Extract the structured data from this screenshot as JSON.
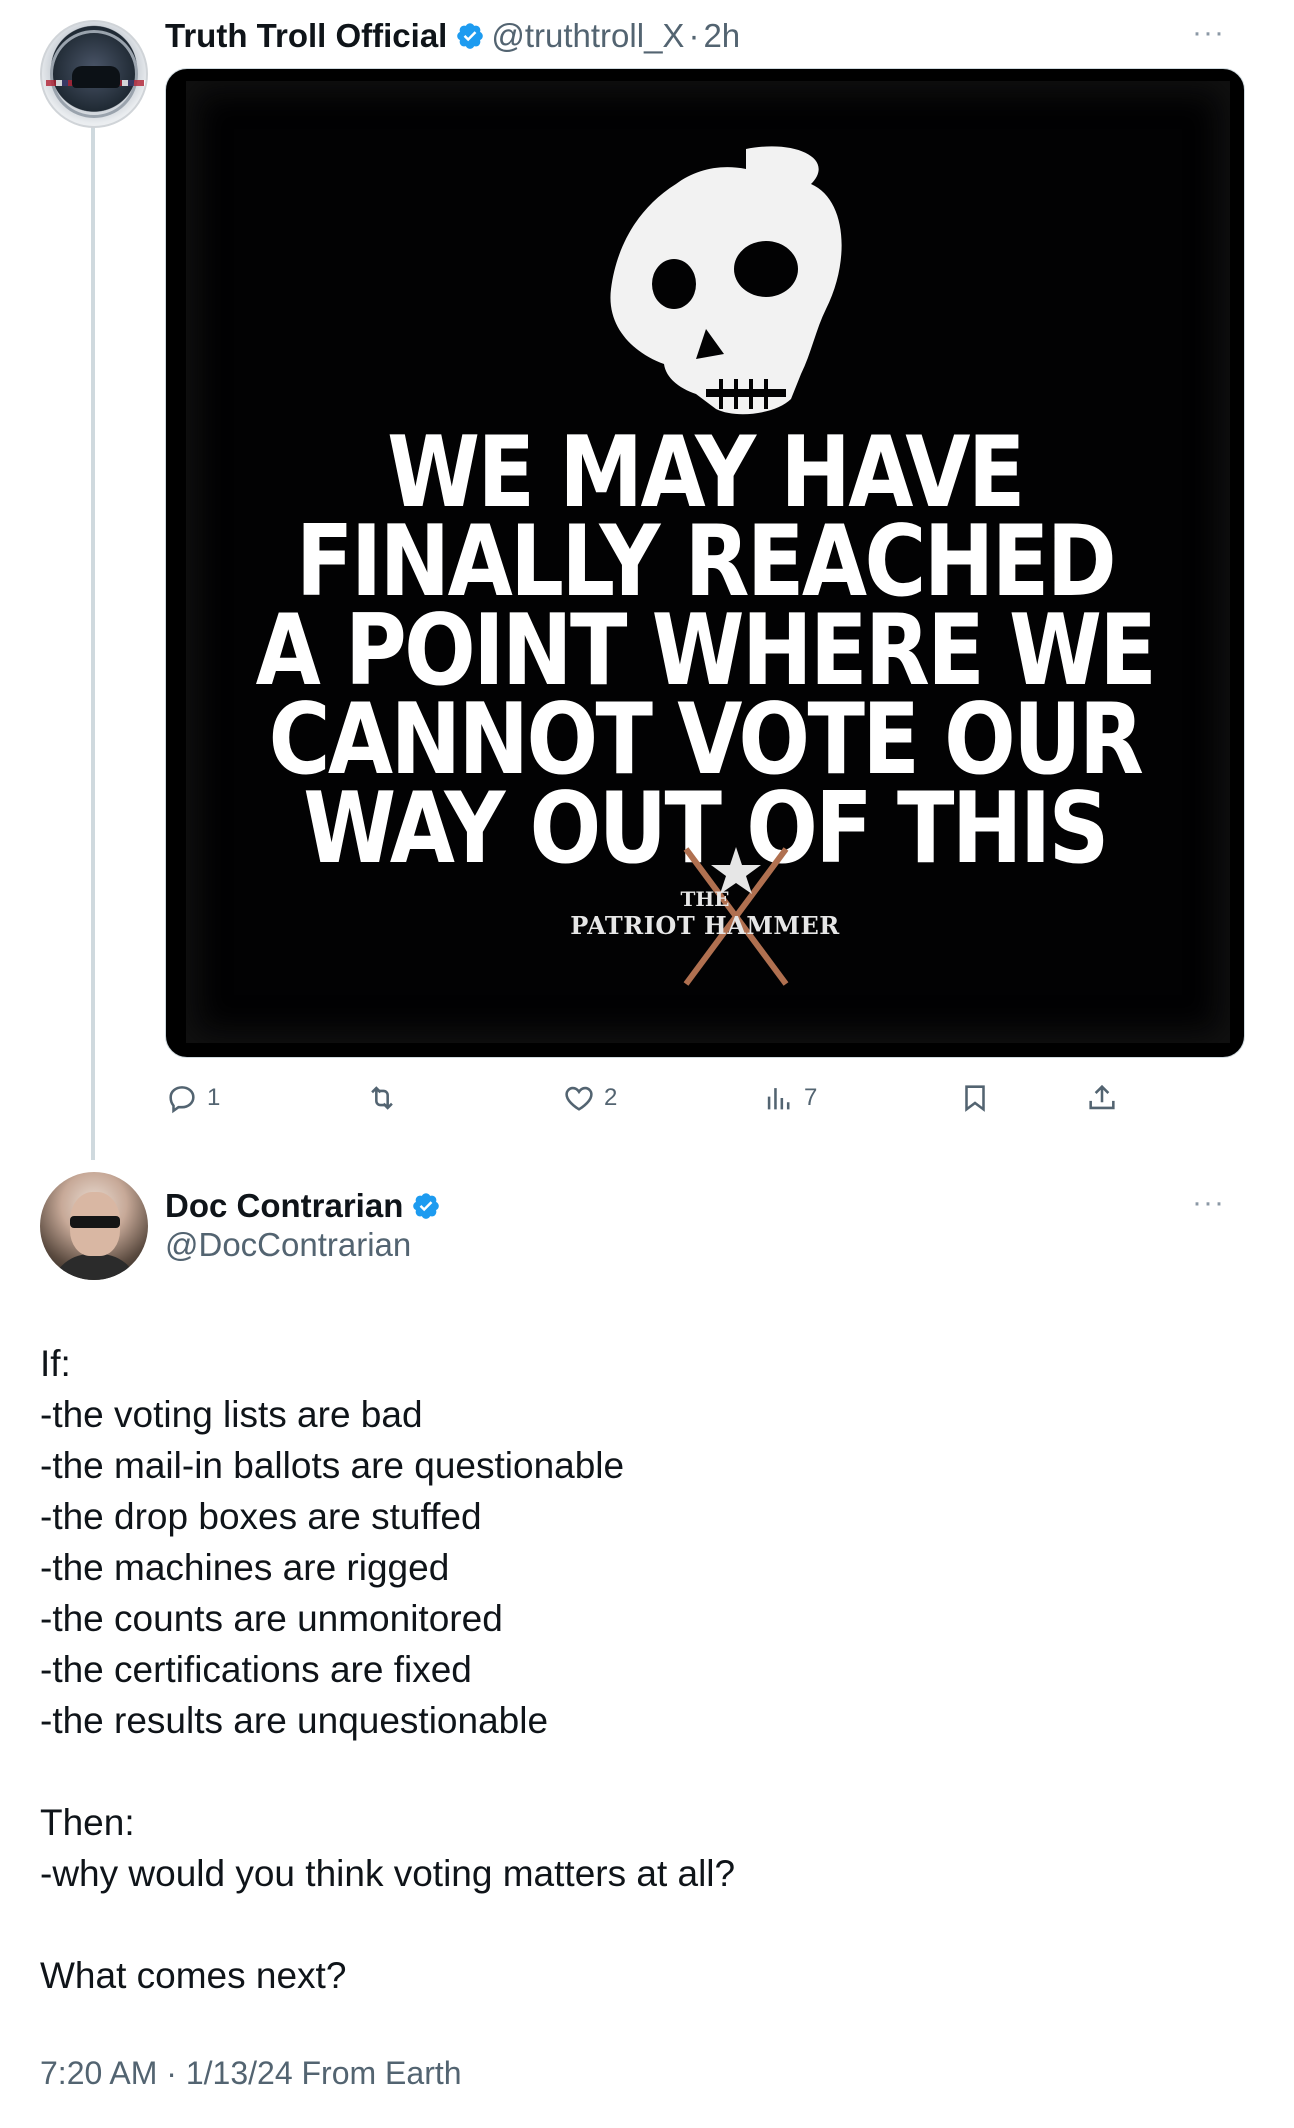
{
  "tweet1": {
    "display_name": "Truth Troll Official",
    "handle": "@truthtroll_X",
    "separator": "·",
    "time": "2h",
    "more_icon": "···",
    "media": {
      "lines": [
        "WE MAY HAVE",
        "FINALLY REACHED",
        "A POINT WHERE WE",
        "CANNOT VOTE OUR",
        "WAY OUT OF THIS"
      ],
      "logo_the": "THE",
      "logo_name": "PATRIOT HAMMER"
    },
    "actions": {
      "reply_count": "1",
      "retweet_count": "",
      "like_count": "2",
      "views_count": "7"
    }
  },
  "tweet2": {
    "display_name": "Doc Contrarian",
    "handle": "@DocContrarian",
    "more_icon": "···",
    "body": {
      "if_label": "If:",
      "conditions": [
        "-the voting lists are bad",
        "-the mail-in ballots are questionable",
        "-the drop boxes are stuffed",
        "-the machines are rigged",
        "-the counts are unmonitored",
        "-the certifications are fixed",
        "-the results are unquestionable"
      ],
      "then_label": "Then:",
      "then_line": "-why would you think voting matters at all?",
      "closing": "What comes next?"
    },
    "timestamp": "7:20 AM · 1/13/24 From Earth"
  },
  "colors": {
    "text_primary": "#0f1419",
    "text_secondary": "#536471",
    "verified_blue": "#1d9bf0",
    "thread_line": "#cfd9de"
  },
  "icons": {
    "reply": "reply-icon",
    "retweet": "retweet-icon",
    "like": "heart-icon",
    "views": "views-icon",
    "bookmark": "bookmark-icon",
    "share": "share-icon",
    "verified": "verified-badge-icon",
    "more": "more-options-icon"
  }
}
